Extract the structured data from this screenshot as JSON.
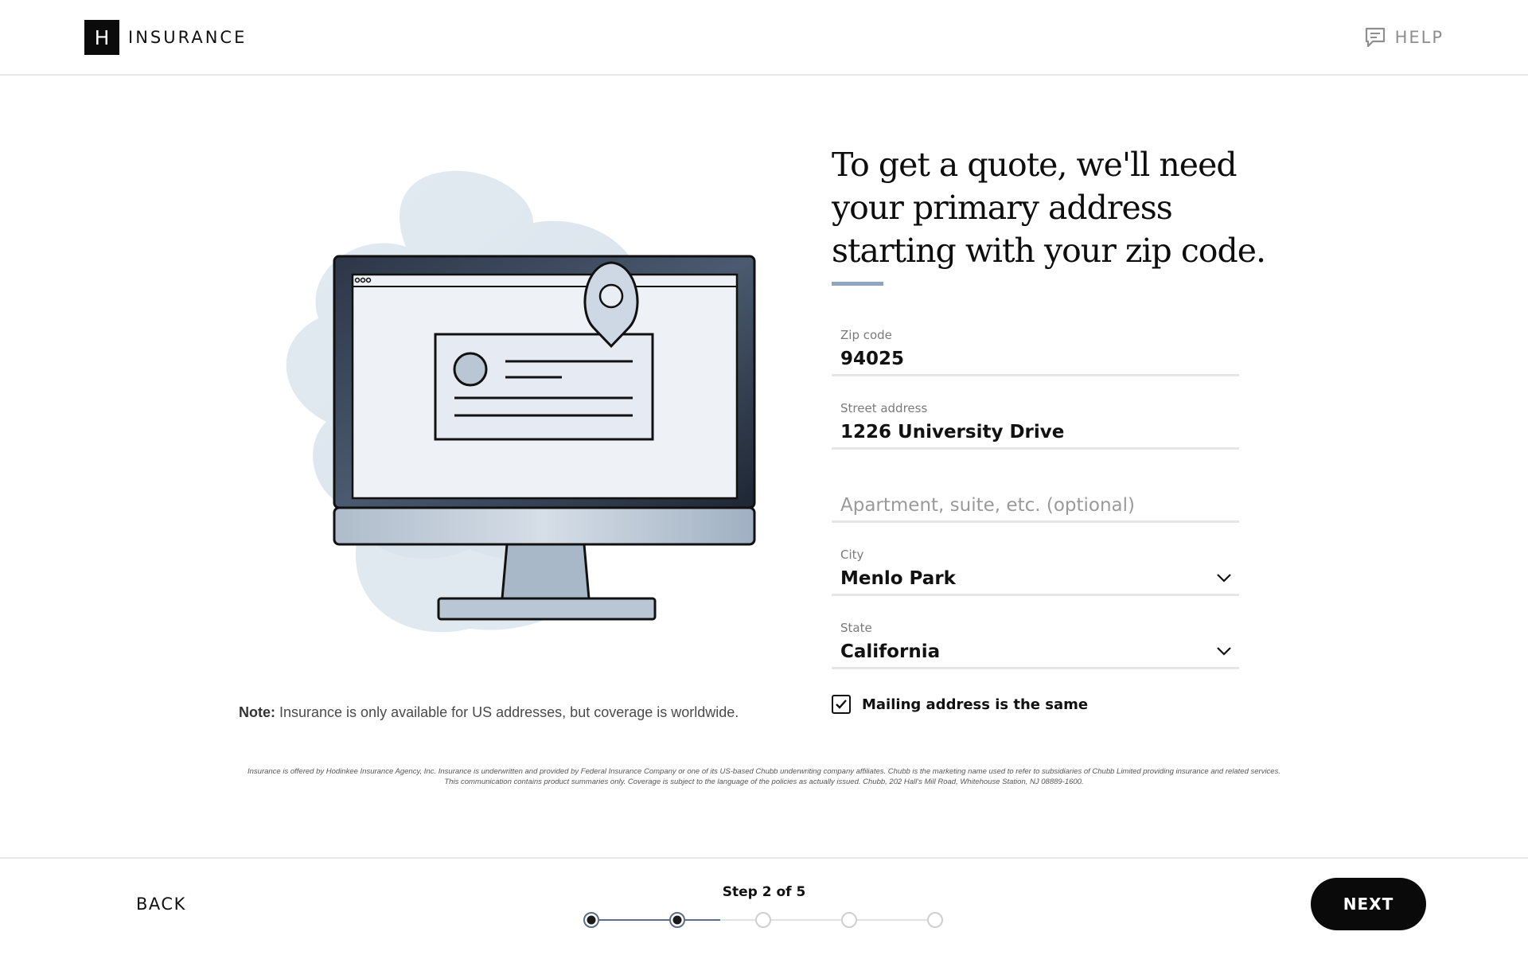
{
  "header": {
    "logo_letter": "H",
    "logo_text": "INSURANCE",
    "help_label": "HELP",
    "help_icon": "chat-bubble-icon"
  },
  "note": {
    "label": "Note:",
    "text": " Insurance is only available for US addresses, but coverage is worldwide."
  },
  "form": {
    "heading": "To get a quote, we'll need your primary address starting with your zip code.",
    "zip": {
      "label": "Zip code",
      "value": "94025"
    },
    "street": {
      "label": "Street address",
      "value": "1226 University Drive"
    },
    "apartment": {
      "placeholder": "Apartment, suite, etc. (optional)"
    },
    "city": {
      "label": "City",
      "value": "Menlo Park"
    },
    "state": {
      "label": "State",
      "value": "California"
    },
    "mailing_same": {
      "label": "Mailing address is the same",
      "checked": true
    }
  },
  "disclaimer": "Insurance is offered by Hodinkee Insurance Agency, Inc. Insurance is underwritten and provided by Federal Insurance Company or one of its US-based Chubb underwriting company affiliates. Chubb is the marketing name used to refer to subsidiaries of Chubb Limited providing insurance and related services. This communication contains product summaries only. Coverage is subject to the language of the policies as actually issued. Chubb, 202 Hall's Mill Road, Whitehouse Station, NJ 08889-1600.",
  "footer": {
    "back_label": "BACK",
    "step_label": "Step 2 of 5",
    "current_step": 2,
    "total_steps": 5,
    "next_label": "NEXT"
  },
  "colors": {
    "accent": "#8fa6bf",
    "button": "#0a0a0a",
    "step_active": "#5a6f8a"
  }
}
